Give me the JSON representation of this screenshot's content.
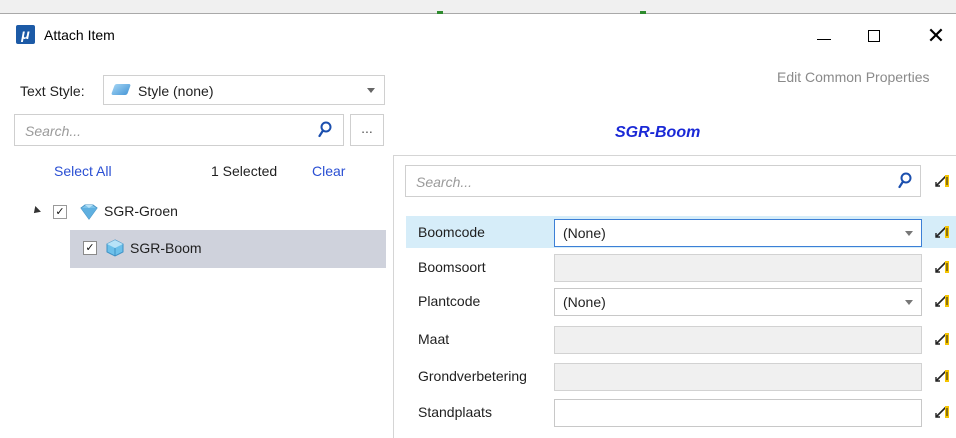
{
  "window": {
    "title": "Attach Item",
    "app_icon_glyph": "μ",
    "minimize_icon": "minimize-icon",
    "maximize_icon": "maximize-icon",
    "close_glyph": "✕"
  },
  "text_style": {
    "label": "Text Style:",
    "value": "Style (none)"
  },
  "edit_common_properties": "Edit Common Properties",
  "left_search": {
    "placeholder": "Search...",
    "more_label": "..."
  },
  "selection": {
    "select_all": "Select All",
    "count_text": "1 Selected",
    "clear": "Clear"
  },
  "tree": {
    "root": {
      "label": "SGR-Groen",
      "checked": true,
      "expanded": true
    },
    "child": {
      "label": "SGR-Boom",
      "checked": true,
      "selected": true
    }
  },
  "right": {
    "title": "SGR-Boom",
    "search_placeholder": "Search..."
  },
  "properties": [
    {
      "label": "Boomcode",
      "value": "(None)",
      "kind": "dropdown",
      "highlighted": true
    },
    {
      "label": "Boomsoort",
      "value": "",
      "kind": "disabled",
      "highlighted": false
    },
    {
      "label": "Plantcode",
      "value": "(None)",
      "kind": "dropdown",
      "highlighted": false
    },
    {
      "label": "Maat",
      "value": "",
      "kind": "disabled",
      "highlighted": false
    },
    {
      "label": "Grondverbetering",
      "value": "",
      "kind": "disabled",
      "highlighted": false
    },
    {
      "label": "Standplaats",
      "value": "",
      "kind": "text",
      "highlighted": false
    }
  ],
  "colors": {
    "link": "#2a4fd3",
    "title_accent": "#1a29d6",
    "selected_row": "#cfd2dc",
    "highlight_row": "#d6edf9"
  }
}
